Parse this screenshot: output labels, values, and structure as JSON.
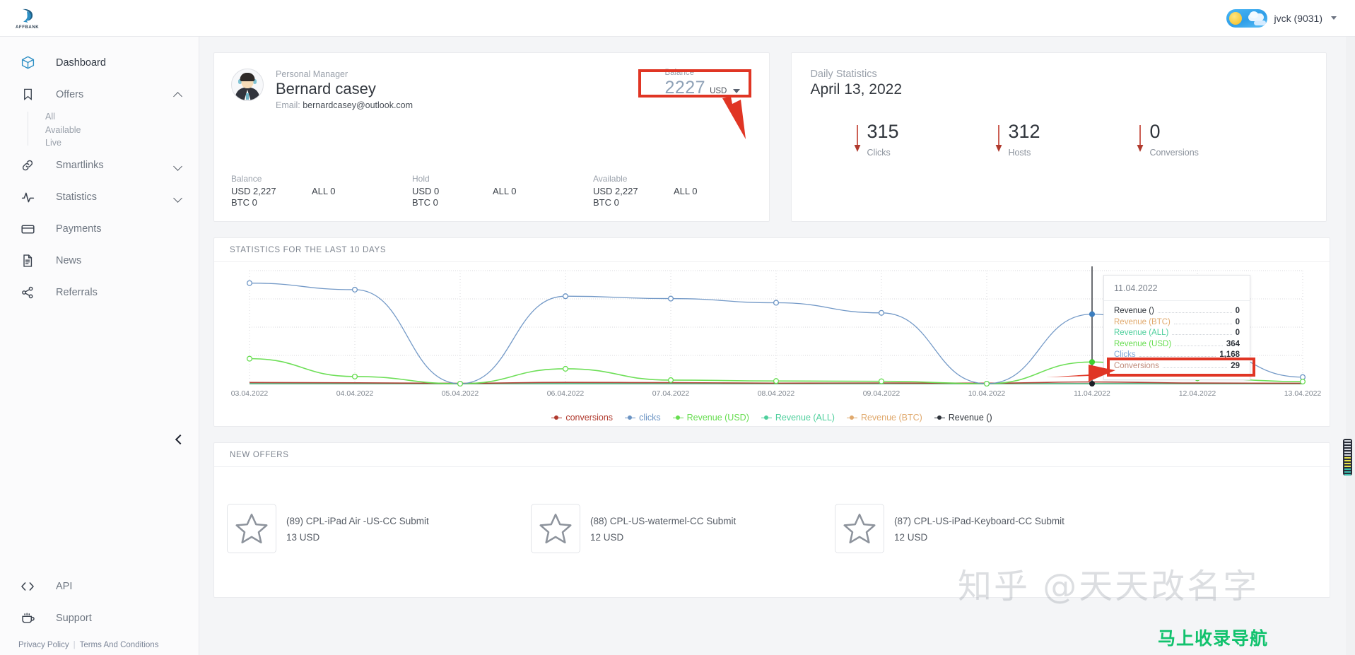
{
  "topbar": {
    "logo_text": "AFFBANK",
    "logo_icon": "affbank-logo-icon",
    "weather_icon": "sun-cloud-icon",
    "user_label": "jvck (9031)"
  },
  "sidebar": {
    "items": [
      {
        "label": "Dashboard",
        "icon": "cube-icon",
        "active": true
      },
      {
        "label": "Offers",
        "icon": "bookmark-icon",
        "expanded": true
      },
      {
        "label": "Smartlinks",
        "icon": "link-icon",
        "expanded": false
      },
      {
        "label": "Statistics",
        "icon": "activity-icon",
        "expanded": false
      },
      {
        "label": "Payments",
        "icon": "credit-card-icon"
      },
      {
        "label": "News",
        "icon": "document-icon"
      },
      {
        "label": "Referrals",
        "icon": "share-icon"
      }
    ],
    "offers_sub": [
      {
        "label": "All"
      },
      {
        "label": "Available"
      },
      {
        "label": "Live"
      }
    ],
    "bottom_items": [
      {
        "label": "API",
        "icon": "code-brackets-icon"
      },
      {
        "label": "Support",
        "icon": "coffee-cup-icon"
      }
    ],
    "footer": {
      "privacy": "Privacy Policy",
      "separator": "|",
      "terms": "Terms And Conditions"
    },
    "collapse_icon": "chevron-left-icon"
  },
  "manager_card": {
    "role": "Personal Manager",
    "name": "Bernard casey",
    "email_label": "Email:",
    "email": "bernardcasey@outlook.com",
    "balance_selector": {
      "label": "Balance",
      "amount": "2227",
      "currency": "USD",
      "caret_icon": "chevron-down-icon"
    },
    "stats": [
      {
        "label": "Balance",
        "rows": [
          {
            "left": "USD 2,227",
            "right": "ALL 0"
          },
          {
            "left": "BTC 0",
            "right": ""
          }
        ]
      },
      {
        "label": "Hold",
        "rows": [
          {
            "left": "USD 0",
            "right": "ALL 0"
          },
          {
            "left": "BTC 0",
            "right": ""
          }
        ]
      },
      {
        "label": "Available",
        "rows": [
          {
            "left": "USD 2,227",
            "right": "ALL 0"
          },
          {
            "left": "BTC 0",
            "right": ""
          }
        ]
      }
    ]
  },
  "daily_statistics": {
    "title": "Daily Statistics",
    "date": "April 13, 2022",
    "metrics": [
      {
        "value": "315",
        "label": "Clicks",
        "trend_icon": "arrow-down-icon"
      },
      {
        "value": "312",
        "label": "Hosts",
        "trend_icon": "arrow-down-icon"
      },
      {
        "value": "0",
        "label": "Conversions",
        "trend_icon": "arrow-down-icon"
      }
    ]
  },
  "chart_card": {
    "title": "STATISTICS FOR THE LAST 10 DAYS",
    "tooltip": {
      "date": "11.04.2022",
      "rows": [
        {
          "label": "Revenue ()",
          "value": "0",
          "color": "#2f343b"
        },
        {
          "label": "Revenue (BTC)",
          "value": "0",
          "color": "#e0a96d"
        },
        {
          "label": "Revenue (ALL)",
          "value": "0",
          "color": "#4ecf9c"
        },
        {
          "label": "Revenue (USD)",
          "value": "364",
          "color": "#66dd4f",
          "highlighted": true
        },
        {
          "label": "Clicks",
          "value": "1,168",
          "color": "#7fa8d8"
        },
        {
          "label": "Conversions",
          "value": "29",
          "color": "#c08b7a"
        }
      ]
    }
  },
  "chart_data": {
    "type": "line",
    "title": "STATISTICS FOR THE LAST 10 DAYS",
    "xlabel": "",
    "ylabel": "",
    "grid": true,
    "legend_position": "bottom",
    "x": [
      "03.04.2022",
      "04.04.2022",
      "05.04.2022",
      "06.04.2022",
      "07.04.2022",
      "08.04.2022",
      "09.04.2022",
      "10.04.2022",
      "11.04.2022",
      "12.04.2022",
      "13.04.2022"
    ],
    "ylim": [
      0,
      1900
    ],
    "series": [
      {
        "name": "conversions",
        "color": "#b03a2e",
        "values": [
          20,
          14,
          6,
          22,
          17,
          9,
          12,
          8,
          29,
          11,
          7
        ]
      },
      {
        "name": "clicks",
        "color": "#6b94c4",
        "values": [
          1690,
          1580,
          0,
          1470,
          1430,
          1360,
          1190,
          0,
          1168,
          620,
          110
        ]
      },
      {
        "name": "Revenue (USD)",
        "color": "#66dd4f",
        "values": [
          420,
          120,
          0,
          250,
          60,
          45,
          40,
          0,
          364,
          90,
          35
        ]
      },
      {
        "name": "Revenue (ALL)",
        "color": "#4ecf9c",
        "values": [
          0,
          0,
          0,
          0,
          0,
          0,
          0,
          0,
          0,
          0,
          0
        ]
      },
      {
        "name": "Revenue (BTC)",
        "color": "#e0a96d",
        "values": [
          0,
          0,
          0,
          0,
          0,
          0,
          0,
          0,
          0,
          0,
          0
        ]
      },
      {
        "name": "Revenue ()",
        "color": "#2f343b",
        "values": [
          0,
          0,
          0,
          0,
          0,
          0,
          0,
          0,
          0,
          0,
          0
        ]
      }
    ],
    "legend": [
      {
        "label": "conversions",
        "color": "#b03a2e"
      },
      {
        "label": "clicks",
        "color": "#6b94c4"
      },
      {
        "label": "Revenue (USD)",
        "color": "#66dd4f"
      },
      {
        "label": "Revenue (ALL)",
        "color": "#4ecf9c"
      },
      {
        "label": "Revenue (BTC)",
        "color": "#e0a96d"
      },
      {
        "label": "Revenue ()",
        "color": "#2f343b"
      }
    ],
    "hover_point": "11.04.2022"
  },
  "offers_card": {
    "title": "NEW OFFERS",
    "offers": [
      {
        "name": "(89) CPL-iPad Air -US-CC Submit",
        "price": "13 USD",
        "icon": "star-icon"
      },
      {
        "name": "(88) CPL-US-watermel-CC Submit",
        "price": "12 USD",
        "icon": "star-icon"
      },
      {
        "name": "(87) CPL-US-iPad-Keyboard-CC Submit",
        "price": "12 USD",
        "icon": "star-icon"
      }
    ]
  },
  "watermarks": {
    "main": "知乎 @天天改名字",
    "green": "马上收录导航"
  },
  "annotations": {
    "accent_color": "#e03524"
  }
}
